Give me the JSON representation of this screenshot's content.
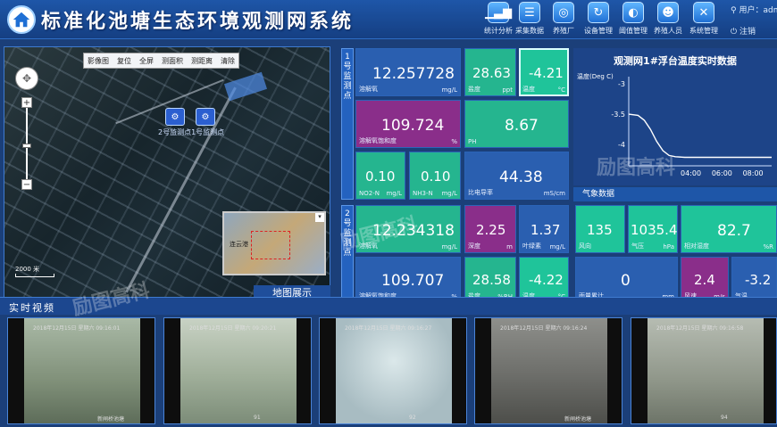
{
  "header": {
    "title": "标准化池塘生态环境观测网系统",
    "nav": [
      "统计分析",
      "采集数据",
      "养殖厂",
      "设备管理",
      "阈值管理",
      "养殖人员",
      "系统管理"
    ],
    "user_label": "用户：adm",
    "logout_label": "注销"
  },
  "map": {
    "tools": [
      "影像图",
      "复位",
      "全屏",
      "测面积",
      "测距离",
      "清除"
    ],
    "markers": [
      "2号监测点",
      "1号监测点"
    ],
    "scale": "2000 米",
    "minimap_label": "连云港",
    "footer": "地图展示"
  },
  "video": {
    "title": "实时视频",
    "feeds": [
      {
        "ts": "2018年12月15日 星期六 09:16:01",
        "cap": "新闸桥池塘"
      },
      {
        "ts": "2018年12月15日 星期六 09:20:21",
        "cap": "91"
      },
      {
        "ts": "2018年12月15日 星期六 09:16:27",
        "cap": "92"
      },
      {
        "ts": "2018年12月15日 星期六 09:16:24",
        "cap": "新闸桥池塘"
      },
      {
        "ts": "2018年12月15日 星期六 09:16:58",
        "cap": "94"
      }
    ]
  },
  "station1": {
    "label": "1号监测点",
    "do": {
      "name": "溶解氧",
      "value": "12.257728",
      "unit": "mg/L"
    },
    "sal": {
      "name": "盐度",
      "value": "28.63",
      "unit": "ppt"
    },
    "temp": {
      "name": "温度",
      "value": "-4.21",
      "unit": "°C"
    },
    "dosat": {
      "name": "溶解氧饱和度",
      "value": "109.724",
      "unit": "%"
    },
    "ph": {
      "name": "PH",
      "value": "8.67",
      "unit": ""
    },
    "no2": {
      "name": "NO2-N",
      "value": "0.10",
      "unit": "mg/L"
    },
    "nh3": {
      "name": "NH3-N",
      "value": "0.10",
      "unit": "mg/L"
    },
    "cond": {
      "name": "比电导率",
      "value": "44.38",
      "unit": "mS/cm"
    }
  },
  "station2": {
    "label": "2号监测点",
    "do": {
      "name": "溶解氧",
      "value": "12.234318",
      "unit": "mg/L"
    },
    "depth": {
      "name": "深度",
      "value": "2.25",
      "unit": "m"
    },
    "chl": {
      "name": "叶绿素",
      "value": "1.37",
      "unit": "mg/L"
    },
    "dosat": {
      "name": "溶解氧饱和度",
      "value": "109.707",
      "unit": "%"
    },
    "sal": {
      "name": "盐度",
      "value": "28.58",
      "unit": "%RH"
    },
    "temp": {
      "name": "温度",
      "value": "-4.22",
      "unit": "°C"
    }
  },
  "weather": {
    "title": "气象数据",
    "wdir": {
      "name": "风向",
      "value": "135",
      "unit": ""
    },
    "press": {
      "name": "气压",
      "value": "1035.4",
      "unit": "hPa"
    },
    "hum": {
      "name": "相对湿度",
      "value": "82.7",
      "unit": "%R"
    },
    "rain": {
      "name": "雨量累计",
      "value": "0",
      "unit": "mm"
    },
    "wspd": {
      "name": "风速",
      "value": "2.4",
      "unit": "m/s"
    },
    "atemp": {
      "name": "气温",
      "value": "-3.2",
      "unit": "℃"
    }
  },
  "watermark": "励图高科",
  "chart_data": {
    "type": "line",
    "title": "观测网1#浮台温度实时数据",
    "ylabel": "温度(Deg C)",
    "xlabel": "",
    "ylim": [
      -4.35,
      -3
    ],
    "yticks": [
      -3,
      -3.5,
      -4
    ],
    "xlim": [
      0,
      9.2
    ],
    "xticks": [
      {
        "label": "04:00",
        "x": 4
      },
      {
        "label": "06:00",
        "x": 6
      },
      {
        "label": "08:00",
        "x": 8
      }
    ],
    "series": [
      {
        "x": [
          0,
          0.6,
          1.0,
          1.4,
          1.8,
          2.2,
          2.6,
          3.0,
          3.6,
          4.2,
          5,
          6,
          7,
          8,
          9.2
        ],
        "y": [
          -3.5,
          -3.52,
          -3.6,
          -3.75,
          -3.95,
          -4.1,
          -4.18,
          -4.2,
          -4.21,
          -4.21,
          -4.21,
          -4.21,
          -4.21,
          -4.21,
          -4.21
        ]
      }
    ],
    "grid": false
  }
}
